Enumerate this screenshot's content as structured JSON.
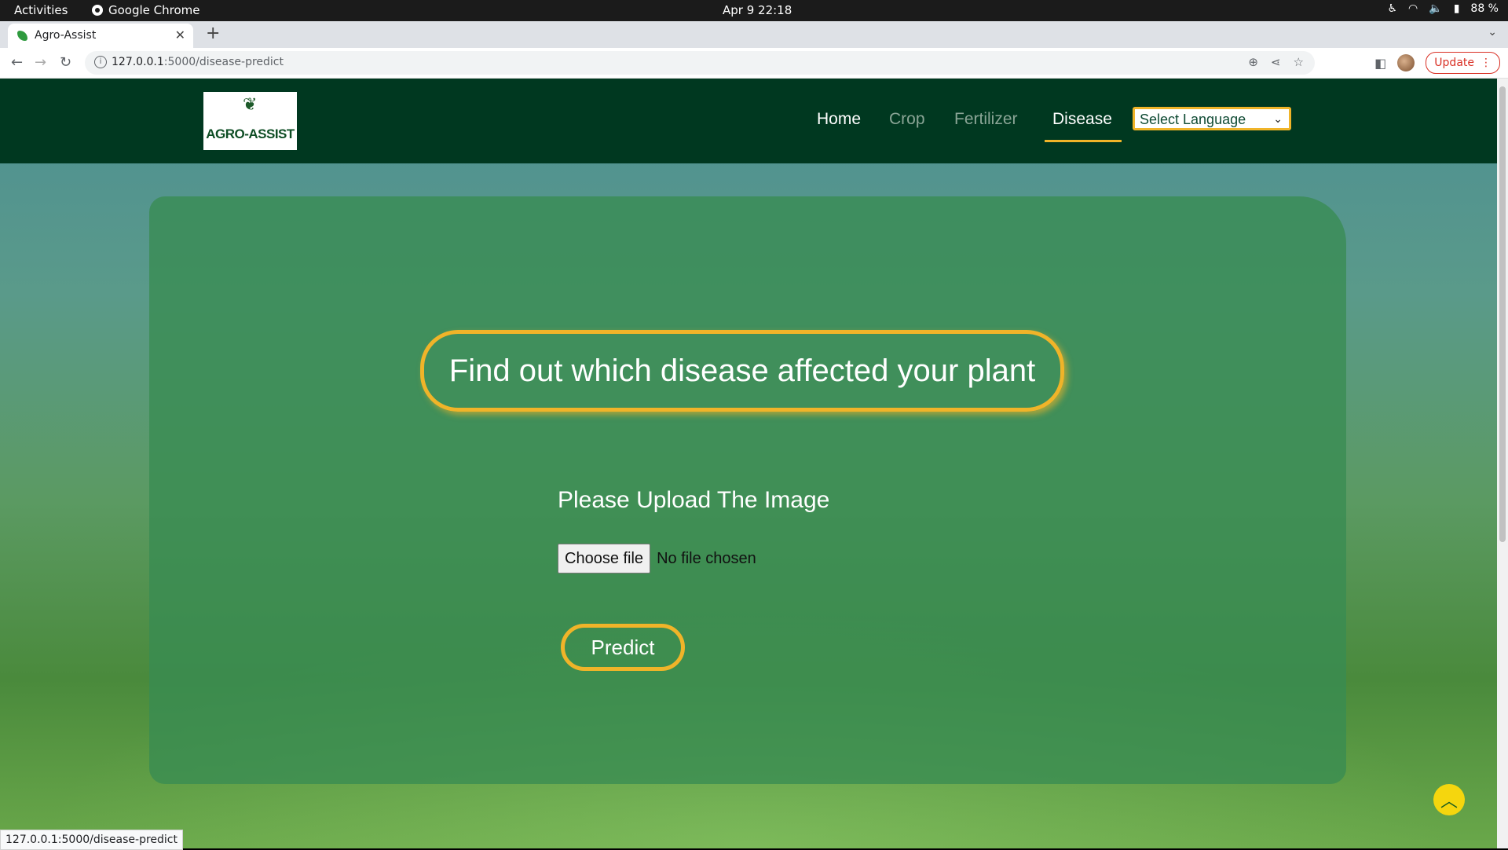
{
  "system": {
    "activities": "Activities",
    "app_name": "Google Chrome",
    "datetime": "Apr 9  22:18",
    "battery": "88 %"
  },
  "browser": {
    "tab_title": "Agro-Assist",
    "url_host": "127.0.0.1",
    "url_path": ":5000/disease-predict",
    "update_label": "Update",
    "status_url": "127.0.0.1:5000/disease-predict"
  },
  "site": {
    "logo_text": "AGRO-ASSIST",
    "nav": [
      {
        "label": "Home"
      },
      {
        "label": "Crop"
      },
      {
        "label": "Fertilizer"
      },
      {
        "label": "Disease"
      }
    ],
    "active_nav": "Disease",
    "language_select": "Select Language"
  },
  "main": {
    "headline": "Find out which disease affected your plant",
    "upload_label": "Please Upload The Image",
    "choose_file_label": "Choose file",
    "no_file_text": "No file chosen",
    "predict_label": "Predict"
  },
  "colors": {
    "nav_bg": "#003820",
    "accent": "#f0b429",
    "card": "#388c52"
  }
}
